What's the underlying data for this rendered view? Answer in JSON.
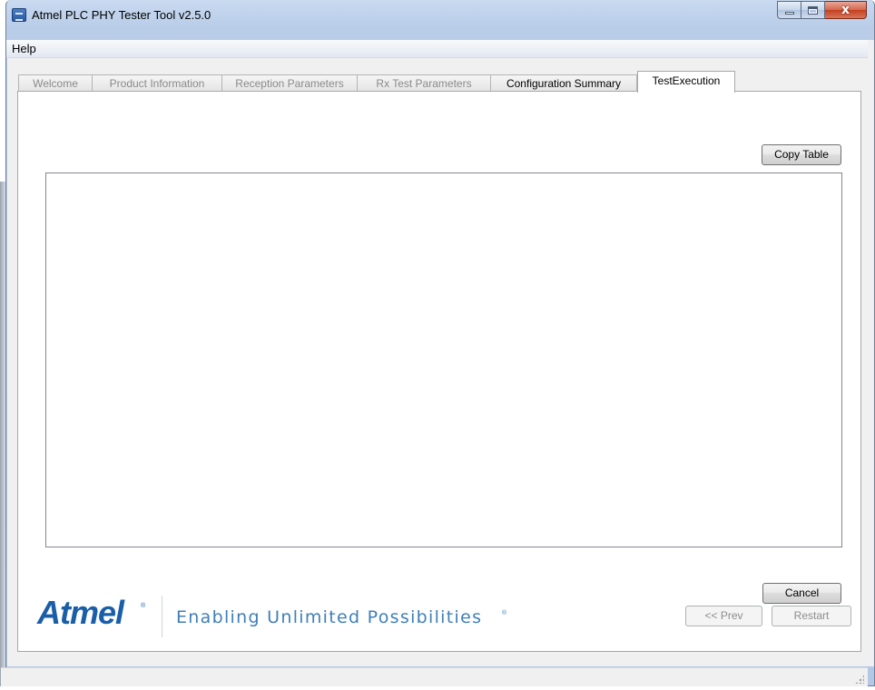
{
  "window": {
    "title": "Atmel PLC PHY Tester Tool v2.5.0",
    "close_glyph": "x"
  },
  "menu": {
    "items": [
      {
        "label": "Help"
      }
    ]
  },
  "tabs": [
    {
      "label": "Welcome",
      "state": "disabled"
    },
    {
      "label": "Product Information",
      "state": "disabled"
    },
    {
      "label": "Reception Parameters",
      "state": "disabled"
    },
    {
      "label": "Rx Test Parameters",
      "state": "disabled"
    },
    {
      "label": "Configuration Summary",
      "state": "enabled"
    },
    {
      "label": "TestExecution",
      "state": "selected"
    }
  ],
  "test_execution": {
    "copy_table_label": "Copy Table",
    "cancel_label": "Cancel",
    "prev_label": "<< Prev",
    "restart_label": "Restart"
  },
  "branding": {
    "logo_text": "Atmel",
    "logo_mark": "®",
    "tagline": "Enabling Unlimited Possibilities",
    "tagline_mark": "®",
    "brand_color": "#1a5ea8"
  },
  "icons": {
    "app": "app-icon",
    "minimize": "minimize-icon",
    "maximize": "maximize-icon",
    "close": "close-icon",
    "resize_grip": "resize-grip-icon"
  }
}
